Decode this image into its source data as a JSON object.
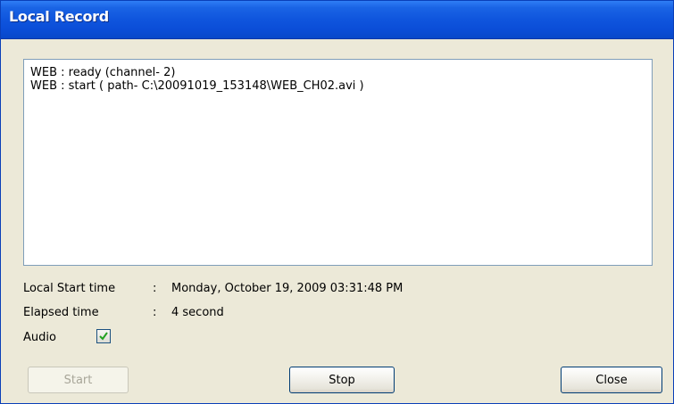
{
  "window": {
    "title": "Local Record"
  },
  "log": {
    "lines": [
      "WEB : ready (channel-  2)",
      "WEB : start ( path- C:\\20091019_153148\\WEB_CH02.avi )"
    ]
  },
  "info": {
    "separator": ":",
    "start_time_label": "Local Start time",
    "start_time_value": "Monday, October 19, 2009 03:31:48 PM",
    "elapsed_label": "Elapsed time",
    "elapsed_value": "4 second",
    "audio_label": "Audio",
    "audio_checked": true
  },
  "buttons": {
    "start_label": "Start",
    "start_enabled": false,
    "stop_label": "Stop",
    "close_label": "Close"
  },
  "colors": {
    "titlebar": "#0b4ed8",
    "checkmark": "#21a121",
    "dialog_bg": "#ece9d8"
  }
}
